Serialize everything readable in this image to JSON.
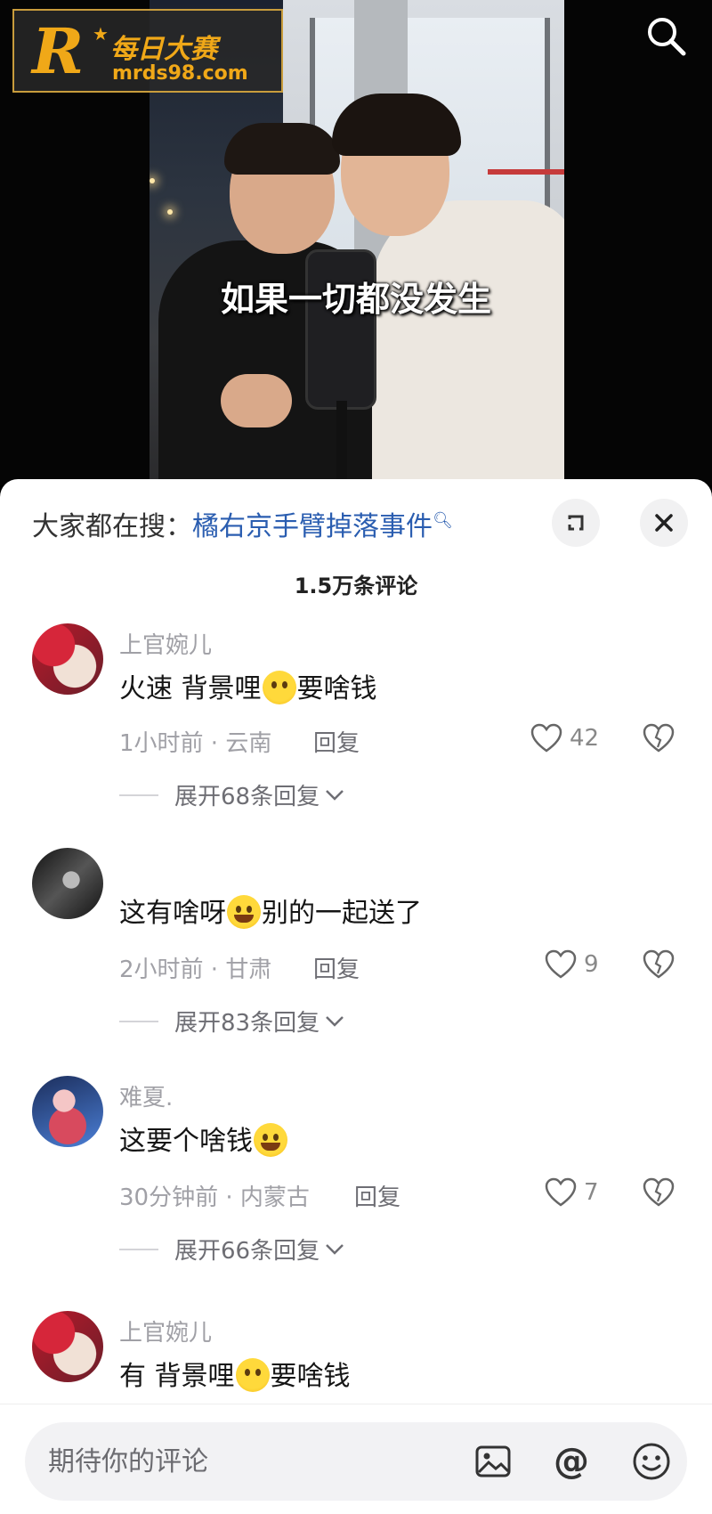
{
  "watermark": {
    "logo_letter": "R",
    "name": "每日大赛",
    "url": "mrds98.com"
  },
  "video": {
    "subtitle": "如果一切都没发生"
  },
  "icons": {
    "search": "search-icon",
    "expand": "fullscreen-expand-icon",
    "close": "close-icon",
    "like": "heart-icon",
    "dislike": "broken-heart-icon",
    "image": "image-icon",
    "mention": "at-icon",
    "emoji": "smiley-icon"
  },
  "hot_search": {
    "prefix": "大家都在搜：",
    "term": "橘右京手臂掉落事件"
  },
  "comment_count": "1.5万条评论",
  "comments": [
    {
      "user": "上官婉儿",
      "text_a": "火速 背景哩",
      "emoji": "flushed-smile-emoji",
      "text_b": "要啥钱",
      "time_loc": "1小时前 · 云南",
      "reply": "回复",
      "likes": "42",
      "expand": "展开68条回复"
    },
    {
      "user": "",
      "text_a": "这有啥呀",
      "emoji": "laugh-cry-emoji",
      "text_b": "别的一起送了",
      "time_loc": "2小时前 · 甘肃",
      "reply": "回复",
      "likes": "9",
      "expand": "展开83条回复"
    },
    {
      "user": "难夏.",
      "text_a": "这要个啥钱",
      "emoji": "laugh-cry-emoji",
      "text_b": "",
      "time_loc": "30分钟前 · 内蒙古",
      "reply": "回复",
      "likes": "7",
      "expand": "展开66条回复"
    },
    {
      "user": "上官婉儿",
      "text_a": "有 背景哩",
      "emoji": "flushed-smile-emoji",
      "text_b": "要啥钱"
    }
  ],
  "input": {
    "placeholder": "期待你的评论"
  }
}
